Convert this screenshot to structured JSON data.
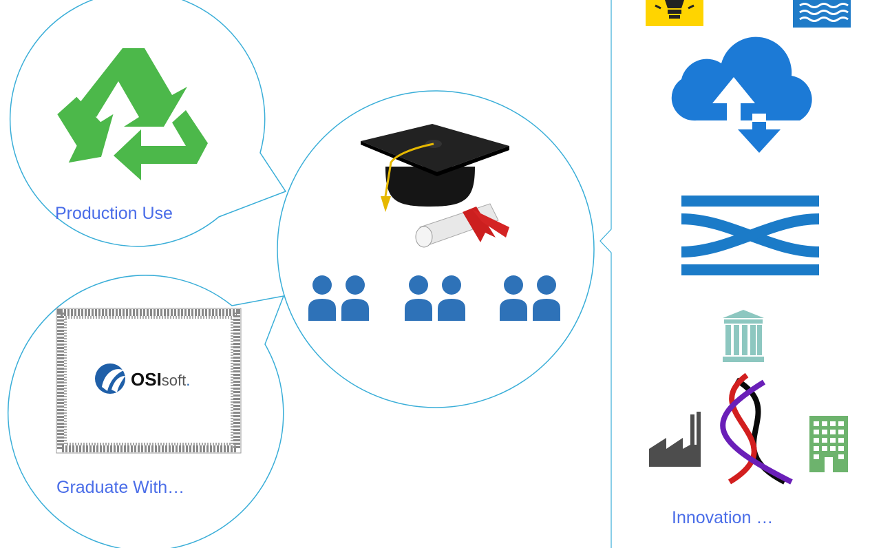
{
  "bubbles": {
    "production": {
      "label": "Production Use"
    },
    "graduate": {
      "label": "Graduate With…"
    }
  },
  "certificate": {
    "brand_bold": "OSI",
    "brand_light": "soft",
    "brand_suffix": "."
  },
  "innovation": {
    "label": "Innovation …"
  },
  "icons": {
    "recycle": "recycle-icon",
    "grad_cap": "graduation-cap-icon",
    "diploma": "diploma-scroll-icon",
    "people": "people-group-icon",
    "lightbulb": "lightbulb-icon",
    "water": "water-waves-icon",
    "cloud": "cloud-upload-download-icon",
    "crossing": "data-crossing-icon",
    "institution": "institution-building-icon",
    "factory": "factory-icon",
    "dna": "dna-helix-icon",
    "office": "office-building-icon"
  },
  "colors": {
    "accent_text": "#4a6de8",
    "bubble_line": "#3aaed8",
    "recycle_green": "#4cb84a",
    "people_blue": "#2e72b8",
    "cloud_blue": "#1c7ad6",
    "crossing_blue": "#1b7bc8"
  }
}
